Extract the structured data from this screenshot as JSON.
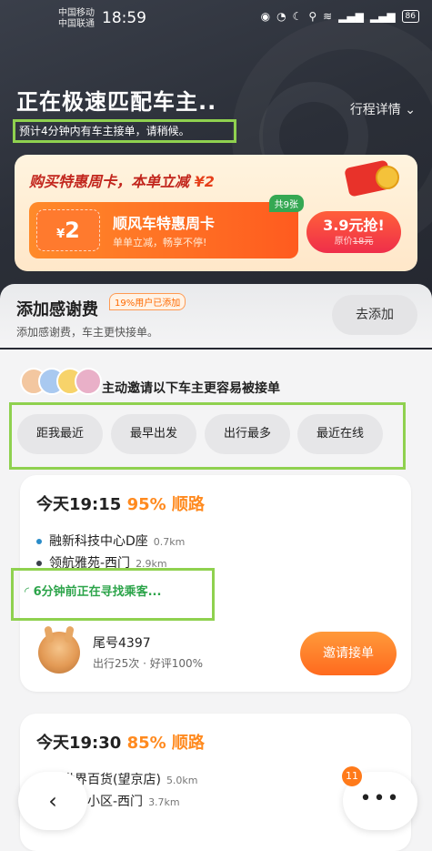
{
  "status_bar": {
    "carrier1": "中国移动",
    "carrier2": "中国联通",
    "time": "18:59",
    "battery": "86"
  },
  "header": {
    "title": "正在极速匹配车主..",
    "detail_link": "行程详情",
    "subtitle": "预计4分钟内有车主接单，请稍候。"
  },
  "promo": {
    "headline_prefix": "购买特惠周卡，本单立减",
    "headline_amount": "¥2",
    "coupon_currency": "¥",
    "coupon_amount": "2",
    "card_name": "顺风车特惠周卡",
    "card_desc": "单单立减，畅享不停!",
    "count_badge": "共9张",
    "buy_price": "3.9元抢!",
    "original_prefix": "原价",
    "original_price": "18元"
  },
  "thanks": {
    "title": "添加感谢费",
    "badge": "19%用户已添加",
    "subtitle": "添加感谢费，车主更快接单。",
    "button": "去添加"
  },
  "invite": {
    "title": "主动邀请以下车主更容易被接单",
    "filters": [
      "距我最近",
      "最早出发",
      "出行最多",
      "最近在线"
    ]
  },
  "trips": [
    {
      "time": "今天19:15",
      "match": "95% 顺路",
      "stops": [
        {
          "name": "融新科技中心D座",
          "distance": "0.7km"
        },
        {
          "name": "领航雅苑-西门",
          "distance": "2.9km"
        }
      ],
      "status": "6分钟前正在寻找乘客...",
      "driver_name": "尾号4397",
      "driver_stats": "出行25次 · 好评100%",
      "invite_button": "邀请接单"
    },
    {
      "time": "今天19:30",
      "match": "85% 顺路",
      "stops": [
        {
          "name": "新世界百货(望京店)",
          "distance": "5.0km"
        },
        {
          "name": "竹花园小区-西门",
          "distance": "3.7km"
        }
      ]
    }
  ],
  "nav": {
    "back_icon": "‹",
    "more_icon": "•••",
    "more_badge": "11"
  },
  "colors": {
    "accent_orange": "#ff8a1f",
    "accent_green": "#2ca44a",
    "highlight_box": "#8fd14f"
  }
}
